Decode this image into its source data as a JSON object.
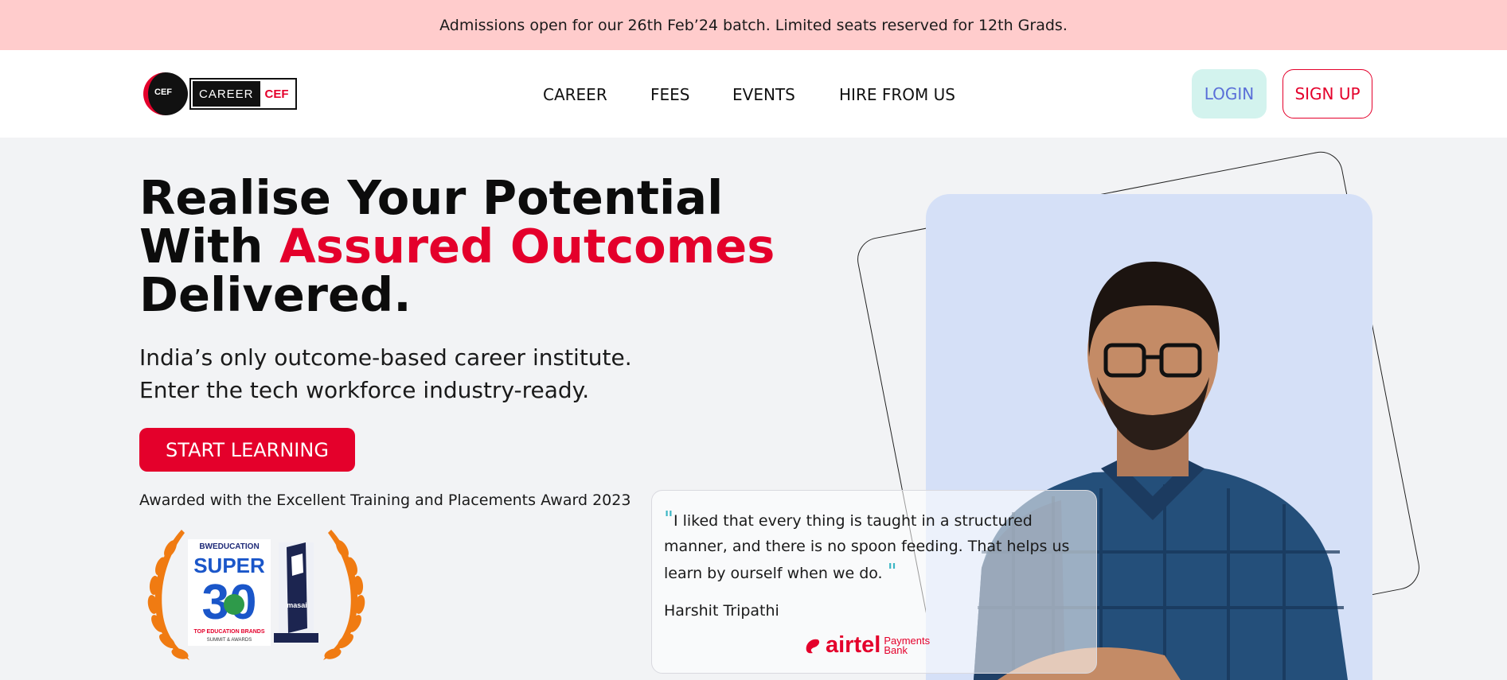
{
  "announcement": "Admissions open for our 26th Feb’24 batch. Limited seats reserved for 12th Grads.",
  "logo": {
    "circle_text": "CEF",
    "career": "CAREER",
    "cef": "CEF"
  },
  "nav": {
    "links": [
      "CAREER",
      "FEES",
      "EVENTS",
      "HIRE FROM US"
    ],
    "login": "LOGIN",
    "signup": "SIGN UP"
  },
  "hero": {
    "title_line1": "Realise Your Potential",
    "title_with": "With ",
    "title_accent": "Assured Outcomes",
    "title_line3": "Delivered.",
    "subtitle_line1": "India’s only outcome-based career institute.",
    "subtitle_line2": "Enter the tech workforce industry-ready.",
    "cta": "START LEARNING",
    "award_text": "Awarded with the Excellent Training and Placements Award 2023"
  },
  "badge": {
    "brand": "BWEDUCATION",
    "super": "SUPER",
    "number": "30",
    "caption1": "TOP EDUCATION BRANDS",
    "caption2": "SUMMIT & AWARDS",
    "trophy_text": "masai"
  },
  "testimonial": {
    "quote": "I liked that every thing is taught in a structured manner, and there is no spoon feeding. That helps us learn by ourself when we do.",
    "name": "Harshit Tripathi",
    "company_word": "airtel",
    "company_sub1": "Payments",
    "company_sub2": "Bank"
  },
  "colors": {
    "accent": "#e4002b",
    "announcement_bg": "#ffcccc",
    "login_bg": "#d3f3ee",
    "photo_bg": "#d5e0f7",
    "quote_mark": "#3bb6c4"
  }
}
